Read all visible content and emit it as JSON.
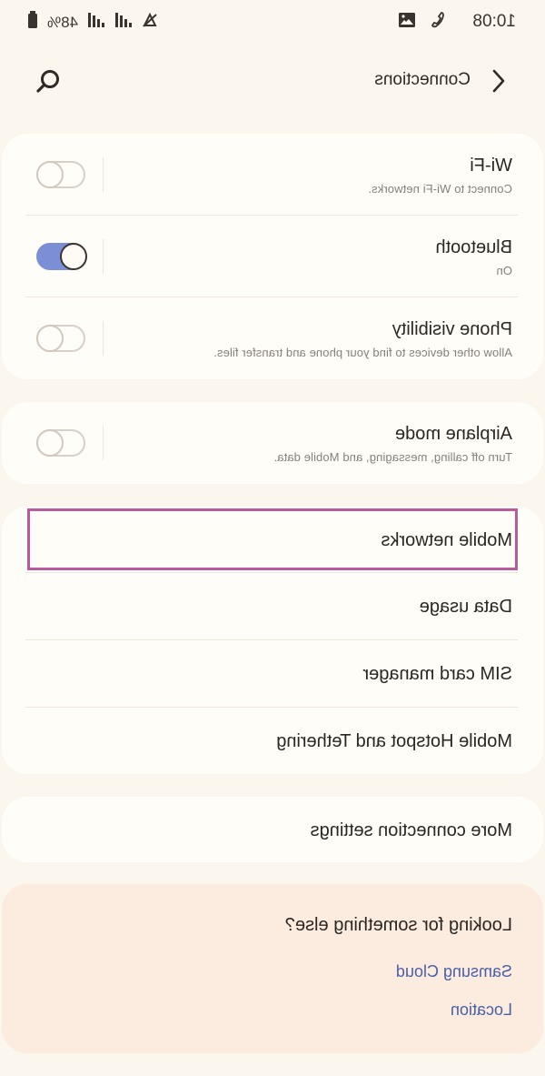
{
  "status": {
    "time": "10:08",
    "battery": "48%",
    "signal_icons": [
      "signal-bars-icon",
      "signal-bars-icon",
      "no-data-icon"
    ],
    "notification_icons": [
      "image-icon",
      "call-icon"
    ]
  },
  "header": {
    "title": "Connections"
  },
  "sections": {
    "wireless": [
      {
        "title": "Wi-Fi",
        "subtitle": "Connect to Wi-Fi networks.",
        "toggle": "off"
      },
      {
        "title": "Bluetooth",
        "subtitle": "On",
        "toggle": "on"
      },
      {
        "title": "Phone visibility",
        "subtitle": "Allow other devices to find your phone and transfer files.",
        "toggle": "off"
      }
    ],
    "airplane": {
      "title": "Airplane mode",
      "subtitle": "Turn off calling, messaging, and Mobile data.",
      "toggle": "off"
    },
    "network": [
      {
        "title": "Mobile networks"
      },
      {
        "title": "Data usage"
      },
      {
        "title": "SIM card manager"
      },
      {
        "title": "Mobile Hotspot and Tethering"
      }
    ],
    "more": {
      "title": "More connection settings"
    },
    "suggest": {
      "title": "Looking for something else?",
      "links": [
        "Samsung Cloud",
        "Location"
      ]
    }
  },
  "colors": {
    "background": "#fcf7ee",
    "card": "#fffdf8",
    "toggle_on": "#7c8fd6",
    "link": "#4a5fa8",
    "highlight": "#b85b9c"
  }
}
